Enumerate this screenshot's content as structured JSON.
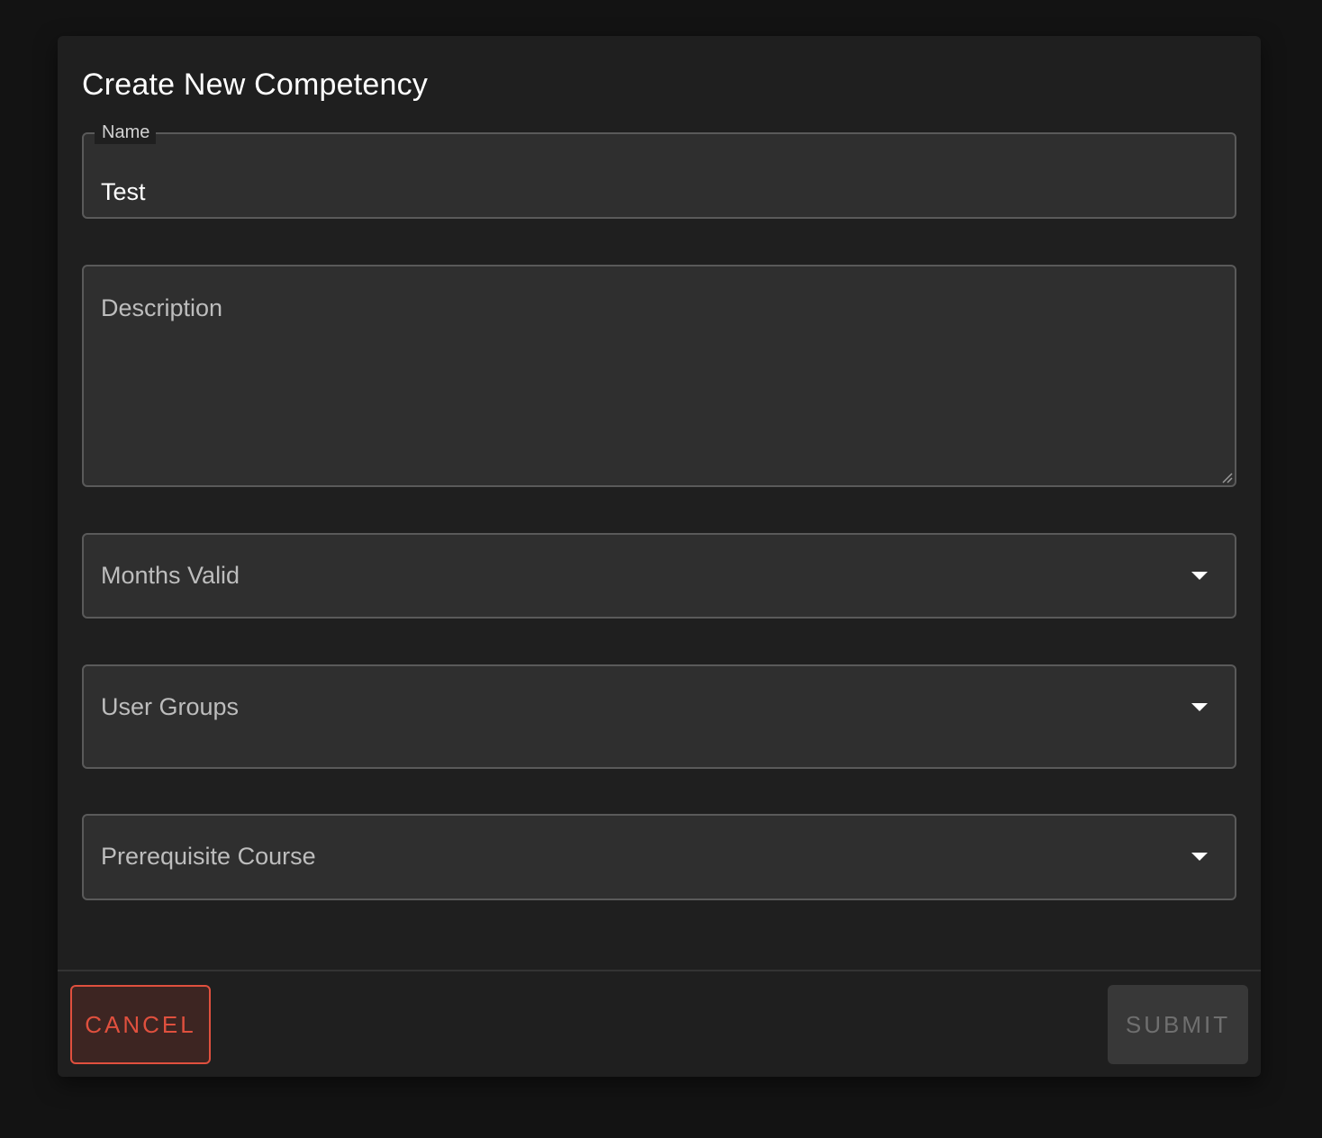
{
  "dialog": {
    "title": "Create New Competency"
  },
  "form": {
    "name": {
      "label": "Name",
      "value": "Test"
    },
    "description": {
      "placeholder": "Description"
    },
    "months_valid": {
      "placeholder": "Months Valid"
    },
    "user_groups": {
      "placeholder": "User Groups"
    },
    "prerequisite_course": {
      "placeholder": "Prerequisite Course"
    }
  },
  "actions": {
    "cancel_label": "CANCEL",
    "submit_label": "SUBMIT"
  },
  "icons": {
    "dropdown": "chevron-down-icon",
    "resize": "resize-grip-icon"
  },
  "colors": {
    "background": "#131313",
    "dialog": "#1f1f1f",
    "field": "#2f2f2f",
    "cancel_accent": "#e0503e",
    "submit_disabled": "#383838"
  }
}
